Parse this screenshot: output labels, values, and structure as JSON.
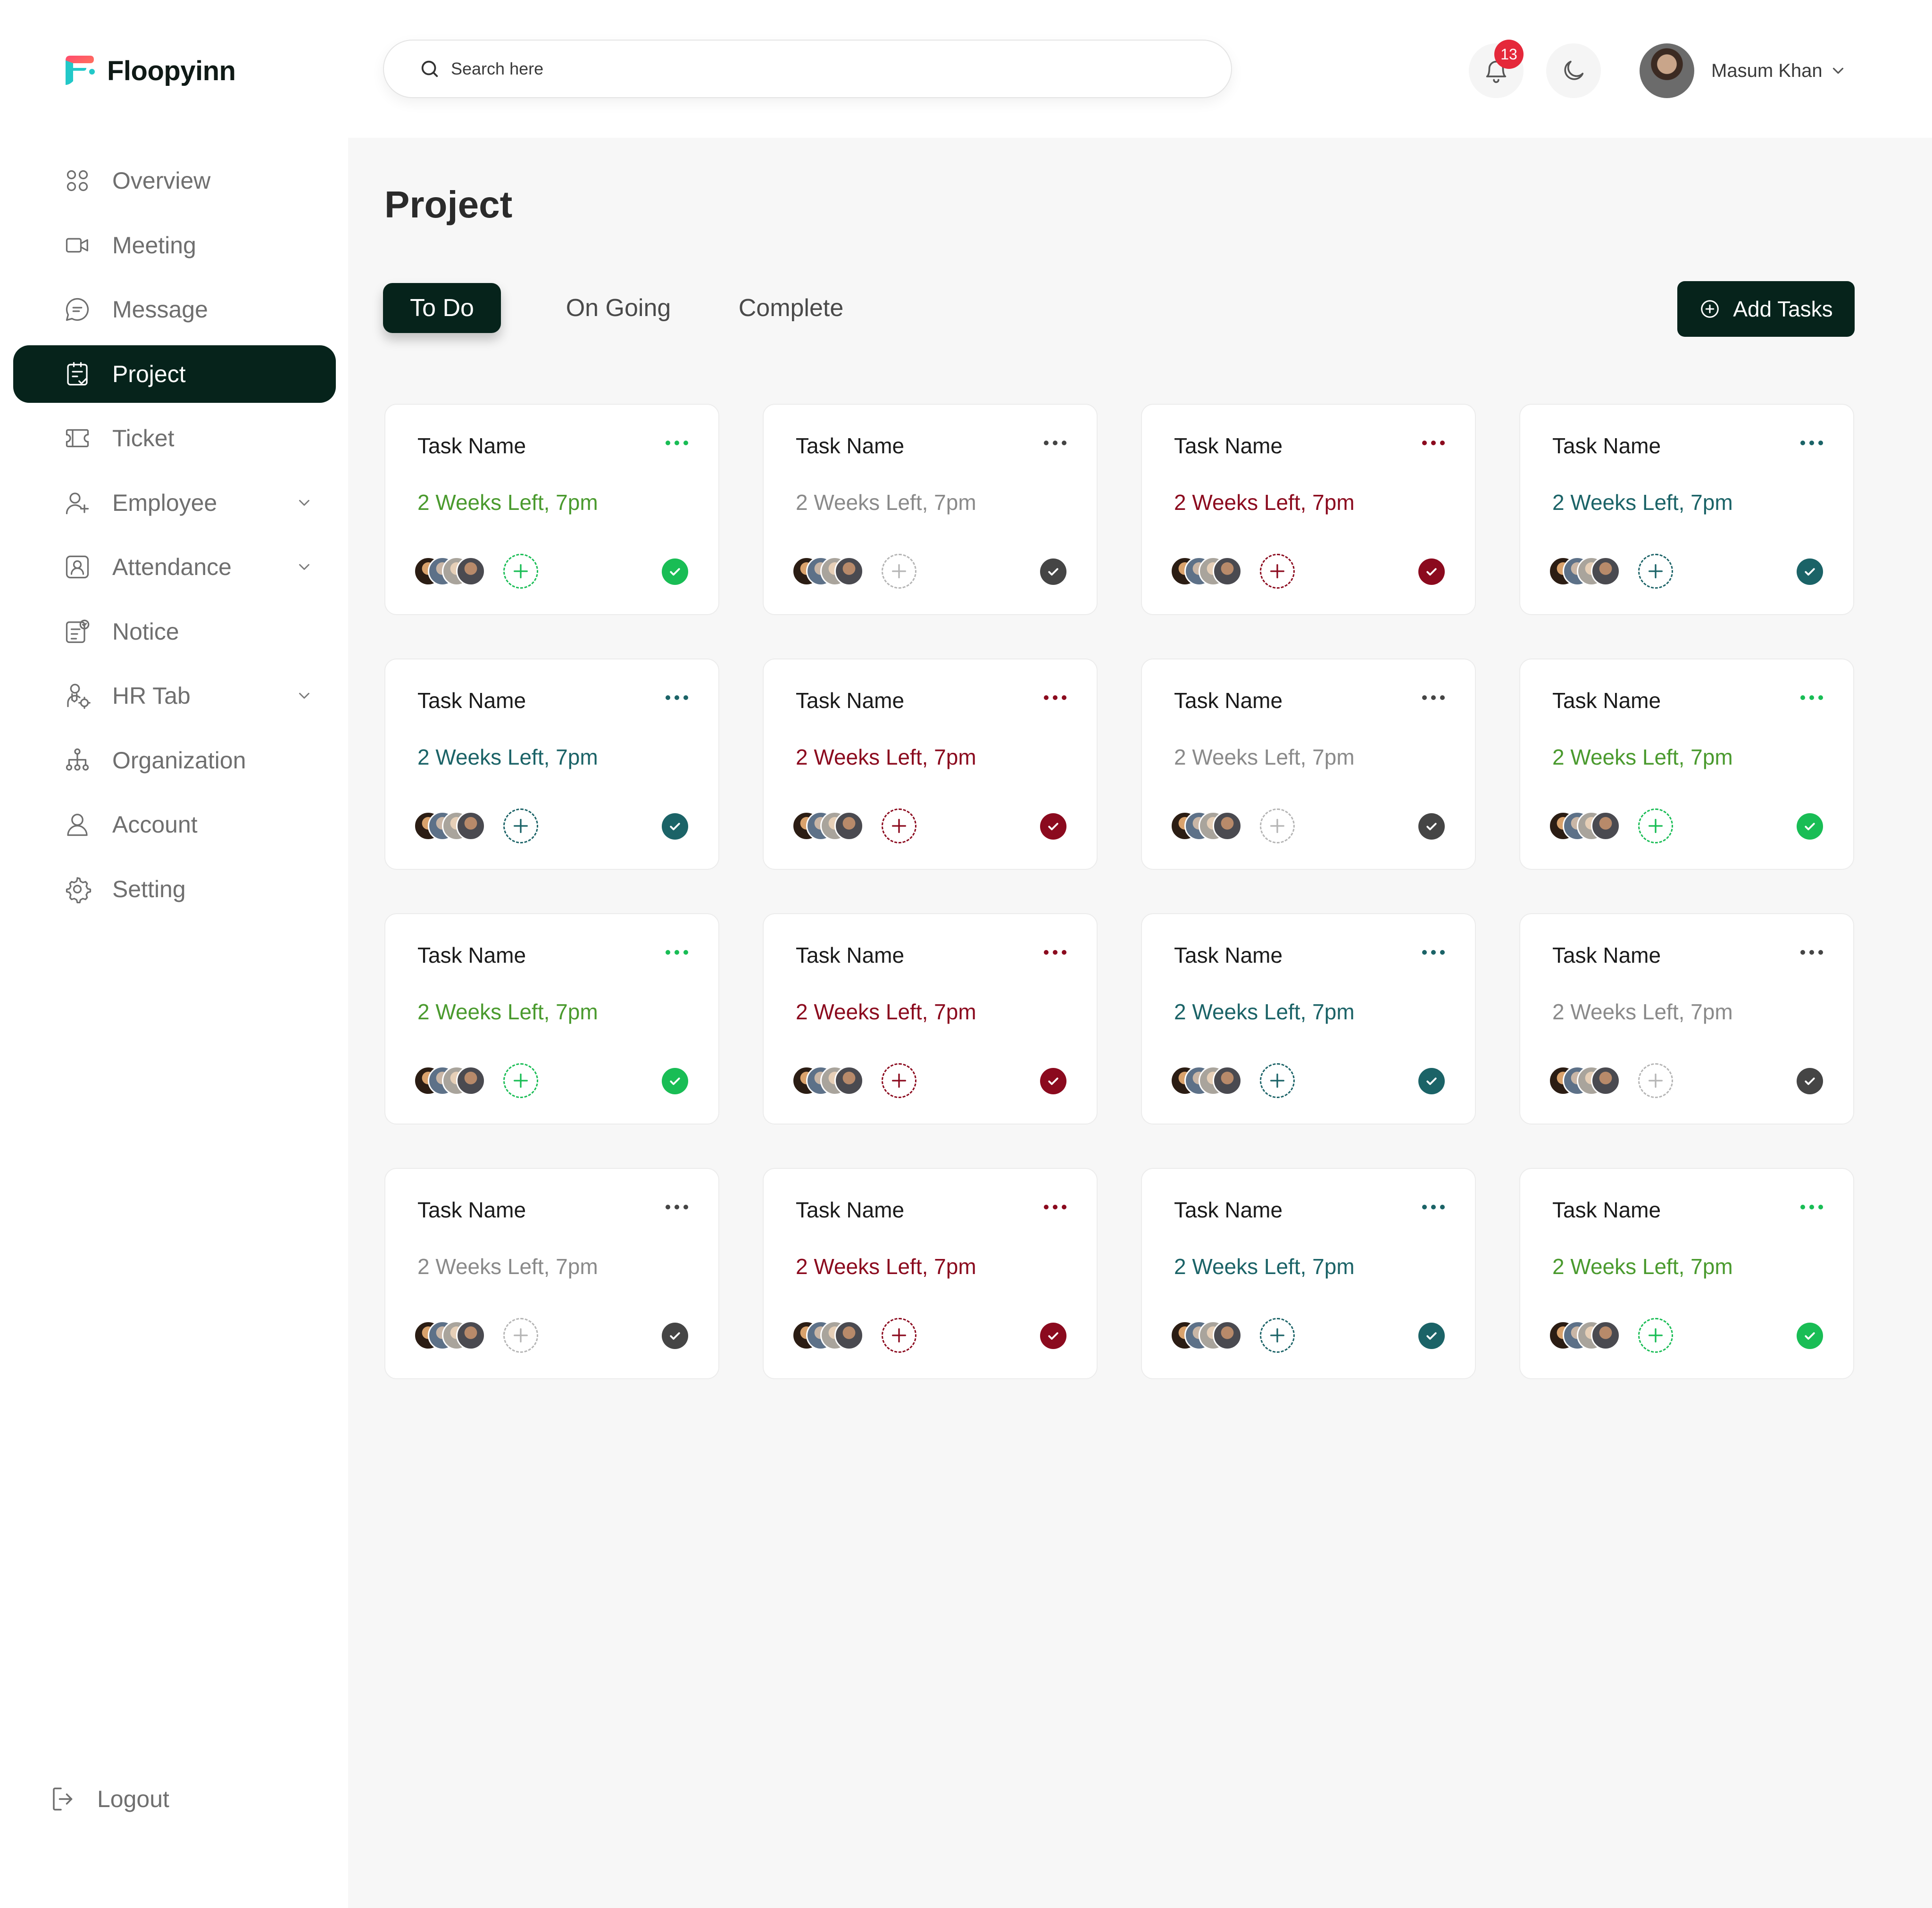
{
  "app": {
    "name": "Floopyinn"
  },
  "header": {
    "search_placeholder": "Search here",
    "notification_count": "13",
    "user_name": "Masum Khan"
  },
  "sidebar": {
    "items": [
      {
        "label": "Overview",
        "icon": "grid-icon",
        "active": false,
        "has_submenu": false
      },
      {
        "label": "Meeting",
        "icon": "video-icon",
        "active": false,
        "has_submenu": false
      },
      {
        "label": "Message",
        "icon": "message-icon",
        "active": false,
        "has_submenu": false
      },
      {
        "label": "Project",
        "icon": "project-icon",
        "active": true,
        "has_submenu": false
      },
      {
        "label": "Ticket",
        "icon": "ticket-icon",
        "active": false,
        "has_submenu": false
      },
      {
        "label": "Employee",
        "icon": "user-add-icon",
        "active": false,
        "has_submenu": true
      },
      {
        "label": "Attendance",
        "icon": "id-card-icon",
        "active": false,
        "has_submenu": true
      },
      {
        "label": "Notice",
        "icon": "notice-icon",
        "active": false,
        "has_submenu": false
      },
      {
        "label": "HR Tab",
        "icon": "hr-icon",
        "active": false,
        "has_submenu": true
      },
      {
        "label": "Organization",
        "icon": "org-icon",
        "active": false,
        "has_submenu": false
      },
      {
        "label": "Account",
        "icon": "account-icon",
        "active": false,
        "has_submenu": false
      },
      {
        "label": "Setting",
        "icon": "gear-icon",
        "active": false,
        "has_submenu": false
      }
    ],
    "logout_label": "Logout"
  },
  "main": {
    "title": "Project",
    "tabs": [
      {
        "label": "To Do",
        "active": true
      },
      {
        "label": "On Going",
        "active": false
      },
      {
        "label": "Complete",
        "active": false
      }
    ],
    "add_button_label": "Add Tasks"
  },
  "colors": {
    "brand_dark": "#06231b",
    "green": "#19bd55",
    "gray": "#454545",
    "red": "#8b0a1e",
    "teal": "#1b6367",
    "due_green": "#4a9a2e",
    "due_gray": "#8a8a8a",
    "due_red": "#8b0a1e",
    "due_teal": "#1b6367"
  },
  "tasks": [
    {
      "name": "Task Name",
      "due": "2 Weeks Left, 7pm",
      "status": "green"
    },
    {
      "name": "Task Name",
      "due": "2 Weeks Left, 7pm",
      "status": "gray"
    },
    {
      "name": "Task Name",
      "due": "2 Weeks Left, 7pm",
      "status": "red"
    },
    {
      "name": "Task Name",
      "due": "2 Weeks Left, 7pm",
      "status": "teal"
    },
    {
      "name": "Task Name",
      "due": "2 Weeks Left, 7pm",
      "status": "teal"
    },
    {
      "name": "Task Name",
      "due": "2 Weeks Left, 7pm",
      "status": "red"
    },
    {
      "name": "Task Name",
      "due": "2 Weeks Left, 7pm",
      "status": "gray"
    },
    {
      "name": "Task Name",
      "due": "2 Weeks Left, 7pm",
      "status": "green"
    },
    {
      "name": "Task Name",
      "due": "2 Weeks Left, 7pm",
      "status": "green"
    },
    {
      "name": "Task Name",
      "due": "2 Weeks Left, 7pm",
      "status": "red"
    },
    {
      "name": "Task Name",
      "due": "2 Weeks Left, 7pm",
      "status": "teal"
    },
    {
      "name": "Task Name",
      "due": "2 Weeks Left, 7pm",
      "status": "gray"
    },
    {
      "name": "Task Name",
      "due": "2 Weeks Left, 7pm",
      "status": "gray"
    },
    {
      "name": "Task Name",
      "due": "2 Weeks Left, 7pm",
      "status": "red"
    },
    {
      "name": "Task Name",
      "due": "2 Weeks Left, 7pm",
      "status": "teal"
    },
    {
      "name": "Task Name",
      "due": "2 Weeks Left, 7pm",
      "status": "green"
    }
  ]
}
